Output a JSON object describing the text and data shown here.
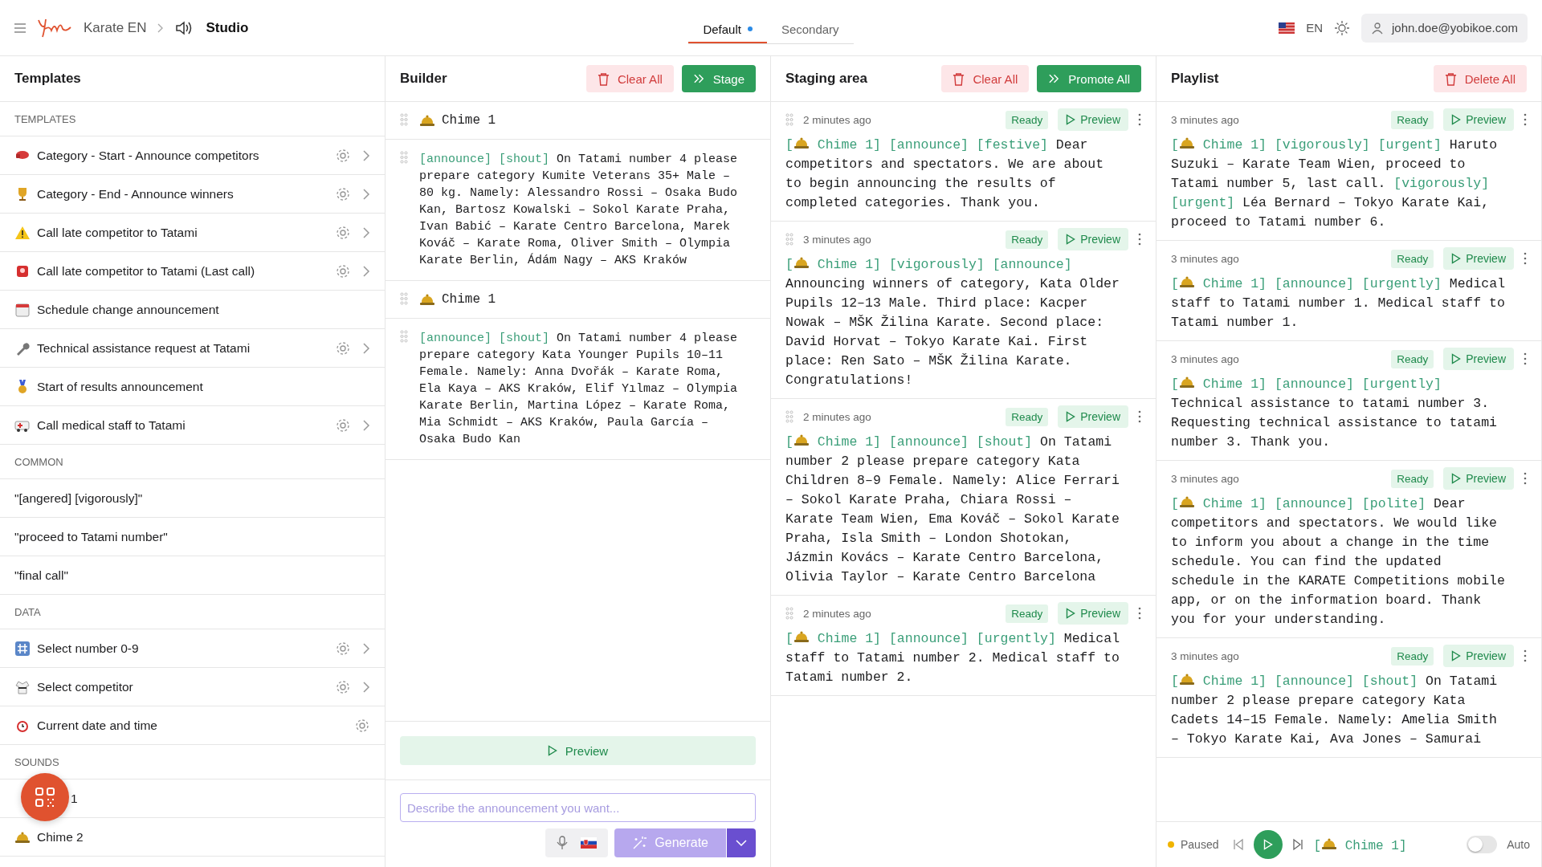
{
  "header": {
    "breadcrumb": [
      "Karate EN",
      "Studio"
    ],
    "tabs": [
      {
        "label": "Default",
        "selected": true,
        "dot": true
      },
      {
        "label": "Secondary",
        "selected": false,
        "dot": false
      }
    ],
    "language": "EN",
    "user": "john.doe@yobikoe.com"
  },
  "templates": {
    "title": "Templates",
    "sections": [
      {
        "heading": "TEMPLATES",
        "items": [
          {
            "label": "Category - Start - Announce competitors",
            "settings": true,
            "submenu": true
          },
          {
            "label": "Category - End - Announce winners",
            "settings": true,
            "submenu": true
          },
          {
            "label": "Call late competitor to Tatami",
            "settings": true,
            "submenu": true
          },
          {
            "label": "Call late competitor to Tatami (Last call)",
            "settings": true,
            "submenu": true
          },
          {
            "label": "Schedule change announcement",
            "settings": false,
            "submenu": false
          },
          {
            "label": "Technical assistance request at Tatami",
            "settings": true,
            "submenu": true
          },
          {
            "label": "Start of results announcement",
            "settings": false,
            "submenu": false
          },
          {
            "label": "Call medical staff to Tatami",
            "settings": true,
            "submenu": true
          }
        ]
      },
      {
        "heading": "COMMON",
        "items": [
          {
            "label": "\"[angered] [vigorously]\"",
            "settings": false,
            "submenu": false
          },
          {
            "label": "\"proceed to Tatami number\"",
            "settings": false,
            "submenu": false
          },
          {
            "label": "\"final call\"",
            "settings": false,
            "submenu": false
          }
        ]
      },
      {
        "heading": "DATA",
        "items": [
          {
            "label": "Select number 0-9",
            "settings": true,
            "submenu": true
          },
          {
            "label": "Select competitor",
            "settings": true,
            "submenu": true
          },
          {
            "label": "Current date and time",
            "settings": true,
            "submenu": false
          }
        ]
      },
      {
        "heading": "SOUNDS",
        "items": [
          {
            "label": "1",
            "settings": false,
            "submenu": false
          },
          {
            "label": "Chime 2",
            "settings": false,
            "submenu": false
          }
        ]
      }
    ]
  },
  "builder": {
    "title": "Builder",
    "clear": "Clear All",
    "stage": "Stage",
    "items": [
      {
        "kind": "sound",
        "label": "Chime 1"
      },
      {
        "kind": "text",
        "segments": [
          {
            "kind": "tag",
            "text": "[announce] [shout]"
          },
          {
            "kind": "plain",
            "text": " On Tatami number 4 please prepare category Kumite Veterans 35+ Male –80 kg. Namely: Alessandro Rossi – Osaka Budo Kan, Bartosz Kowalski – Sokol Karate Praha, Ivan Babić – Karate Centro Barcelona, Marek Kováč – Karate Roma, Oliver Smith – Olympia Karate Berlin, Ádám Nagy – AKS Kraków"
          }
        ]
      },
      {
        "kind": "sound",
        "label": "Chime 1"
      },
      {
        "kind": "text",
        "segments": [
          {
            "kind": "tag",
            "text": "[announce] [shout]"
          },
          {
            "kind": "plain",
            "text": " On Tatami number 4 please prepare category Kata Younger Pupils 10–11 Female. Namely: Anna Dvořák – Karate Roma, Ela Kaya – AKS Kraków, Elif Yılmaz – Olympia Karate Berlin, Martina López – Karate Roma, Mia Schmidt – AKS Kraków, Paula García – Osaka Budo Kan"
          }
        ]
      }
    ],
    "preview": "Preview",
    "placeholder": "Describe the announcement you want...",
    "generate": "Generate",
    "generate_disabled": true
  },
  "staging": {
    "title": "Staging area",
    "clear": "Clear All",
    "promote": "Promote All",
    "items": [
      {
        "time": "2 minutes ago",
        "status": "Ready",
        "preview": "Preview",
        "segments": [
          {
            "kind": "tag",
            "text": "["
          },
          {
            "kind": "bell"
          },
          {
            "kind": "tag",
            "text": " Chime 1] [announce] [festive]"
          },
          {
            "kind": "plain",
            "text": " Dear competitors and spectators. We are about to begin announcing the results of completed categories. Thank you."
          }
        ]
      },
      {
        "time": "3 minutes ago",
        "status": "Ready",
        "preview": "Preview",
        "segments": [
          {
            "kind": "tag",
            "text": "["
          },
          {
            "kind": "bell"
          },
          {
            "kind": "tag",
            "text": " Chime 1] [vigorously] [announce]"
          },
          {
            "kind": "plain",
            "text": " Announcing winners of category, Kata Older Pupils 12–13 Male. Third place: Kacper Nowak – MŠK Žilina Karate. Second place: David Horvat – Tokyo Karate Kai. First place: Ren Sato – MŠK Žilina Karate. Congratulations!"
          }
        ]
      },
      {
        "time": "2 minutes ago",
        "status": "Ready",
        "preview": "Preview",
        "segments": [
          {
            "kind": "tag",
            "text": "["
          },
          {
            "kind": "bell"
          },
          {
            "kind": "tag",
            "text": " Chime 1] [announce] [shout]"
          },
          {
            "kind": "plain",
            "text": " On Tatami number 2 please prepare category Kata Children 8–9 Female. Namely: Alice Ferrari – Sokol Karate Praha, Chiara Rossi – Karate Team Wien, Ema Kováč – Sokol Karate Praha, Isla Smith – London Shotokan, Jázmin Kovács – Karate Centro Barcelona, Olivia Taylor – Karate Centro Barcelona"
          }
        ]
      },
      {
        "time": "2 minutes ago",
        "status": "Ready",
        "preview": "Preview",
        "segments": [
          {
            "kind": "tag",
            "text": "["
          },
          {
            "kind": "bell"
          },
          {
            "kind": "tag",
            "text": " Chime 1] [announce] [urgently]"
          },
          {
            "kind": "plain",
            "text": " Medical staff to Tatami number 2. Medical staff to Tatami number 2."
          }
        ]
      }
    ]
  },
  "playlist": {
    "title": "Playlist",
    "delete": "Delete All",
    "items": [
      {
        "time": "3 minutes ago",
        "status": "Ready",
        "preview": "Preview",
        "segments": [
          {
            "kind": "tag",
            "text": "["
          },
          {
            "kind": "bell"
          },
          {
            "kind": "tag",
            "text": " Chime 1] [vigorously] [urgent]"
          },
          {
            "kind": "plain",
            "text": " Haruto Suzuki – Karate Team Wien, proceed to Tatami number 5, last call. "
          },
          {
            "kind": "tag",
            "text": "[vigorously] [urgent]"
          },
          {
            "kind": "plain",
            "text": " Léa Bernard – Tokyo Karate Kai, proceed to Tatami number 6."
          }
        ]
      },
      {
        "time": "3 minutes ago",
        "status": "Ready",
        "preview": "Preview",
        "segments": [
          {
            "kind": "tag",
            "text": "["
          },
          {
            "kind": "bell"
          },
          {
            "kind": "tag",
            "text": " Chime 1] [announce] [urgently]"
          },
          {
            "kind": "plain",
            "text": " Medical staff to Tatami number 1. Medical staff to Tatami number 1."
          }
        ]
      },
      {
        "time": "3 minutes ago",
        "status": "Ready",
        "preview": "Preview",
        "segments": [
          {
            "kind": "tag",
            "text": "["
          },
          {
            "kind": "bell"
          },
          {
            "kind": "tag",
            "text": " Chime 1] [announce] [urgently]"
          },
          {
            "kind": "plain",
            "text": " Technical assistance to tatami number 3. Requesting technical assistance to tatami number 3. Thank you."
          }
        ]
      },
      {
        "time": "3 minutes ago",
        "status": "Ready",
        "preview": "Preview",
        "segments": [
          {
            "kind": "tag",
            "text": "["
          },
          {
            "kind": "bell"
          },
          {
            "kind": "tag",
            "text": " Chime 1] [announce] [polite]"
          },
          {
            "kind": "plain",
            "text": " Dear competitors and spectators. We would like to inform you about a change in the time schedule. You can find the updated schedule in the KARATE Competitions mobile app, or on the information board. Thank you for your understanding."
          }
        ]
      },
      {
        "time": "3 minutes ago",
        "status": "Ready",
        "preview": "Preview",
        "segments": [
          {
            "kind": "tag",
            "text": "["
          },
          {
            "kind": "bell"
          },
          {
            "kind": "tag",
            "text": " Chime 1] [announce] [shout]"
          },
          {
            "kind": "plain",
            "text": " On Tatami number 2 please prepare category Kata Cadets 14–15 Female. Namely: Amelia Smith – Tokyo Karate Kai, Ava Jones – Samurai"
          }
        ]
      }
    ],
    "player": {
      "state": "Paused",
      "playing": false,
      "now": [
        {
          "kind": "tag",
          "text": "["
        },
        {
          "kind": "bell"
        },
        {
          "kind": "tag",
          "text": " Chime 1]"
        }
      ],
      "auto_label": "Auto",
      "auto": false
    }
  }
}
